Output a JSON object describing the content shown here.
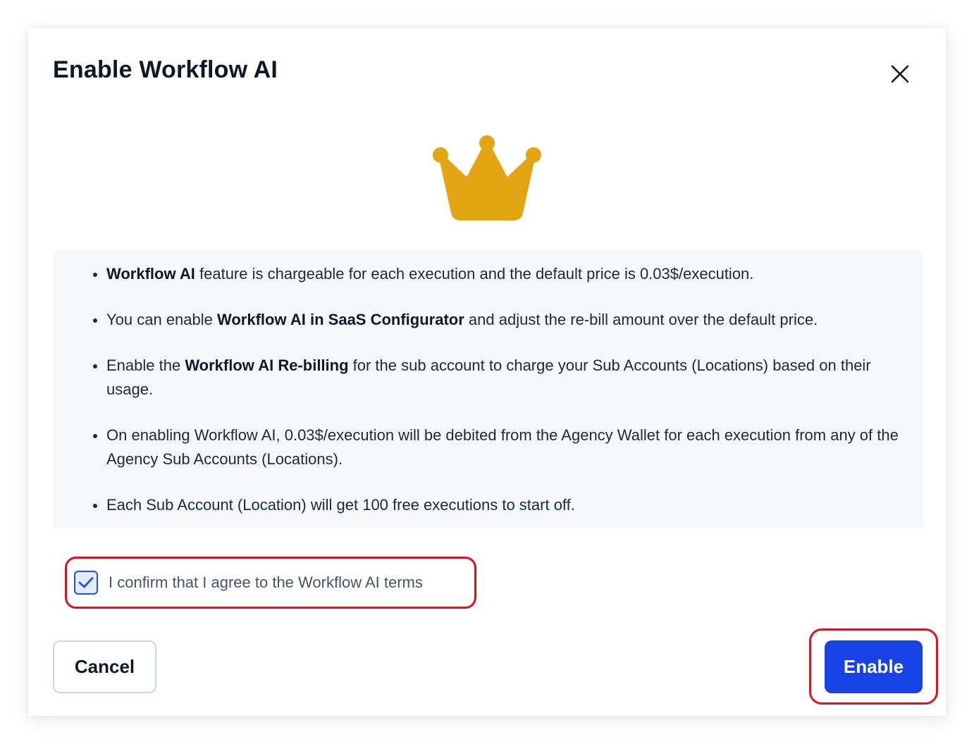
{
  "dialog": {
    "title": "Enable Workflow AI",
    "crown_icon": "crown-icon",
    "close_icon": "close-icon"
  },
  "info": {
    "items": [
      {
        "parts": [
          {
            "text": "Workflow AI",
            "bold": true
          },
          {
            "text": " feature is chargeable for each execution and the default price is 0.03$/execution.",
            "bold": false
          }
        ]
      },
      {
        "parts": [
          {
            "text": "You can enable ",
            "bold": false
          },
          {
            "text": "Workflow AI in SaaS Configurator",
            "bold": true
          },
          {
            "text": " and adjust the re-bill amount over the default price.",
            "bold": false
          }
        ]
      },
      {
        "parts": [
          {
            "text": "Enable the ",
            "bold": false
          },
          {
            "text": "Workflow AI Re-billing",
            "bold": true
          },
          {
            "text": " for the sub account to charge your Sub Accounts (Locations) based on their usage.",
            "bold": false
          }
        ]
      },
      {
        "parts": [
          {
            "text": "On enabling Workflow AI, 0.03$/execution will be debited from the Agency Wallet for each execution from any of the Agency Sub Accounts (Locations).",
            "bold": false
          }
        ]
      },
      {
        "parts": [
          {
            "text": "Each Sub Account (Location) will get 100 free executions to start off.",
            "bold": false
          }
        ]
      }
    ]
  },
  "confirm": {
    "label": "I confirm that I agree to the Workflow AI terms",
    "checked": true
  },
  "footer": {
    "cancel_label": "Cancel",
    "enable_label": "Enable"
  },
  "colors": {
    "primary": "#1742e6",
    "crown": "#e3a612",
    "highlight": "#e0101d",
    "info_bg": "#f7f8fa"
  }
}
